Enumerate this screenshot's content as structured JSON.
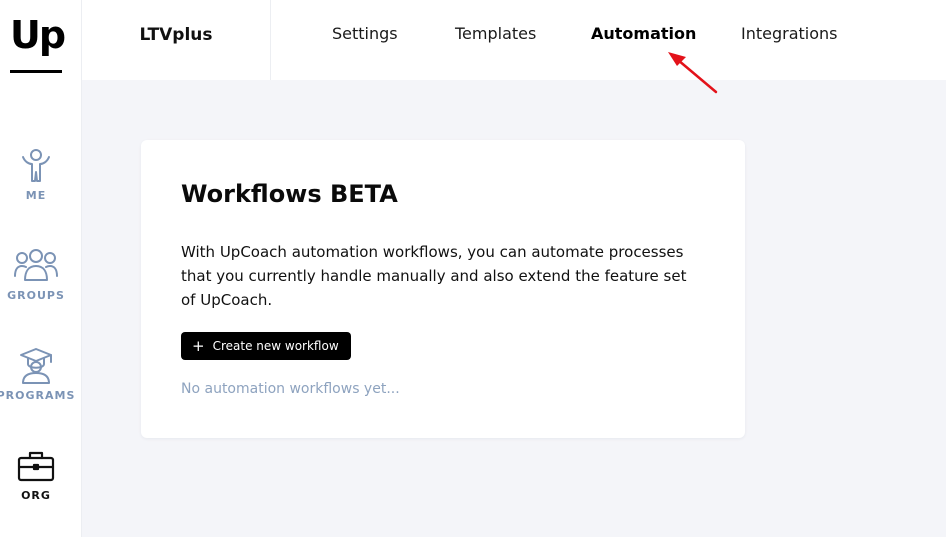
{
  "logo": {
    "text": "Up"
  },
  "sidebar": {
    "items": [
      {
        "label": "ME",
        "icon": "person-icon",
        "active": false
      },
      {
        "label": "GROUPS",
        "icon": "group-icon",
        "active": false
      },
      {
        "label": "PROGRAMS",
        "icon": "graduation-cap-icon",
        "active": false
      },
      {
        "label": "ORG",
        "icon": "briefcase-icon",
        "active": true
      }
    ]
  },
  "header": {
    "org_name": "LTVplus",
    "tabs": [
      {
        "label": "Settings",
        "active": false
      },
      {
        "label": "Templates",
        "active": false
      },
      {
        "label": "Automation",
        "active": true
      },
      {
        "label": "Integrations",
        "active": false
      }
    ]
  },
  "main": {
    "title": "Workflows BETA",
    "description": "With UpCoach automation workflows, you can automate processes that you currently handle manually and also extend the feature set of UpCoach.",
    "create_button": {
      "icon": "plus-icon",
      "label": "Create new workflow"
    },
    "empty_message": "No automation workflows yet..."
  },
  "colors": {
    "accent": "#000000",
    "muted_icon": "#7b93b5",
    "background": "#f4f5f9",
    "annotation": "#e3121a"
  }
}
